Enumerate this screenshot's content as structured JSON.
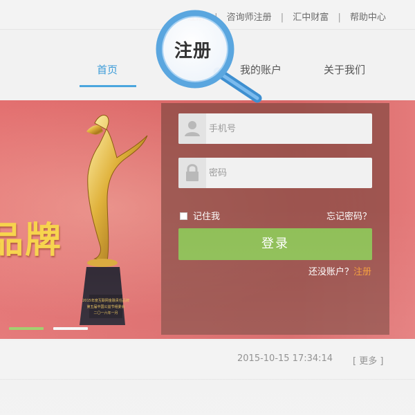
{
  "topbar": {
    "links": [
      "注册",
      "咨询师注册",
      "汇中财富",
      "帮助中心"
    ],
    "separator": "|"
  },
  "nav": {
    "items": [
      "首页",
      "我的账户",
      "关于我们"
    ],
    "active": "首页"
  },
  "banner": {
    "text": "品牌",
    "trophy_plaque": {
      "line1": "2015年度互联网金融责任品牌",
      "line2": "第五届中国公益节组委会",
      "line3": "二〇一六年一月"
    }
  },
  "login": {
    "phone_placeholder": "手机号",
    "password_placeholder": "密码",
    "remember_label": "记住我",
    "forgot_label": "忘记密码？",
    "submit_label": "登录",
    "no_account_text": "还没账户？",
    "register_link": "注册"
  },
  "magnifier": {
    "text": "注册"
  },
  "news": {
    "date": "2015-10-15 17:34:14",
    "more_label": "[ 更多 ]"
  },
  "colors": {
    "nav_active": "#3b9bd8",
    "login_button": "#8fbf57",
    "register_link": "#f39b3a",
    "banner": "#dd6a6a",
    "magnifier_ring": "#5aa6df"
  },
  "icons": {
    "phone_field": "user-icon",
    "password_field": "lock-icon"
  }
}
